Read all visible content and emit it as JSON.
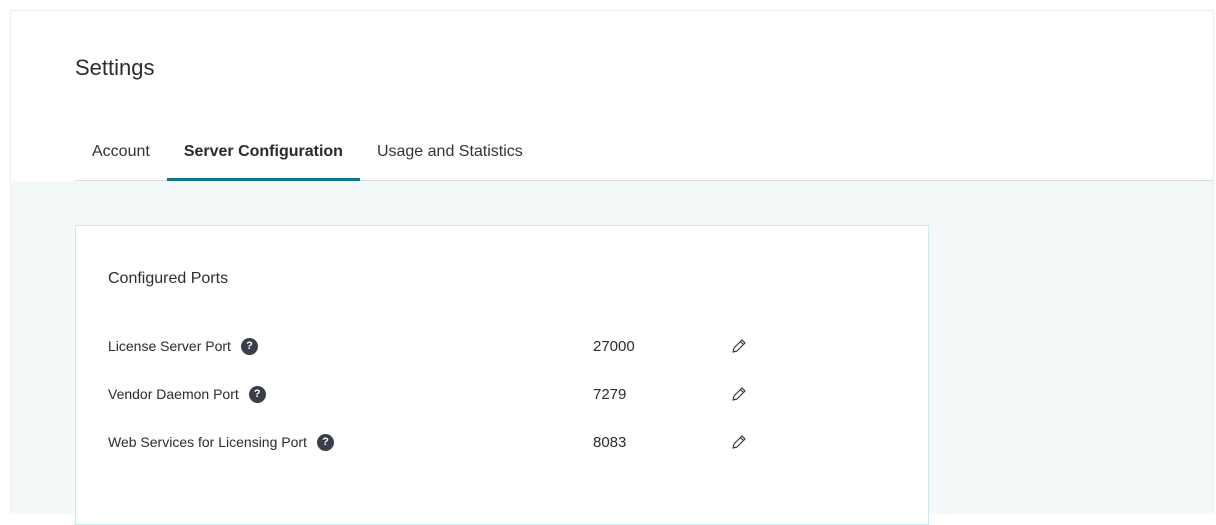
{
  "page": {
    "title": "Settings"
  },
  "tabs": [
    {
      "label": "Account",
      "active": false
    },
    {
      "label": "Server Configuration",
      "active": true
    },
    {
      "label": "Usage and Statistics",
      "active": false
    }
  ],
  "colors": {
    "accent": "#0f7487",
    "content_background": "#f3f8f9",
    "card_border": "#c9ebee",
    "help_icon": "#3b3f4a"
  },
  "card": {
    "title": "Configured Ports",
    "ports": [
      {
        "label": "License Server Port",
        "value": "27000",
        "help_icon": "question-circle-icon",
        "edit_icon": "pencil-icon"
      },
      {
        "label": "Vendor Daemon Port",
        "value": "7279",
        "help_icon": "question-circle-icon",
        "edit_icon": "pencil-icon"
      },
      {
        "label": "Web Services for Licensing Port",
        "value": "8083",
        "help_icon": "question-circle-icon",
        "edit_icon": "pencil-icon"
      }
    ],
    "help_glyph": "?"
  }
}
